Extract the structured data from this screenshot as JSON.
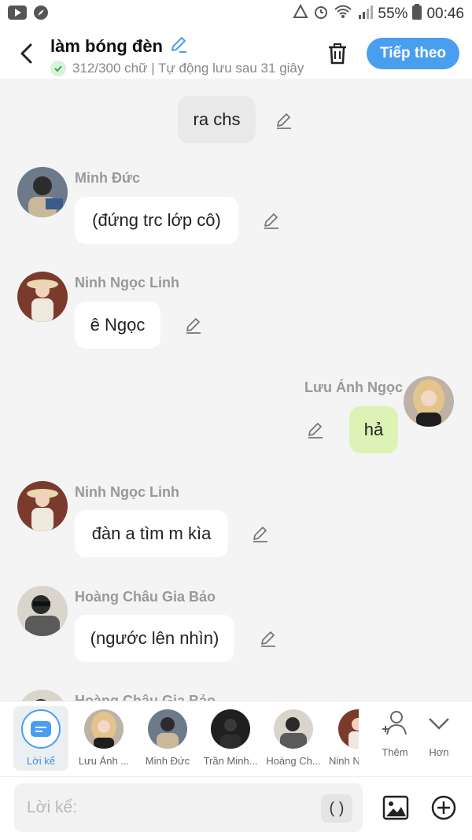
{
  "status_bar": {
    "left_icons": [
      "youtube-icon",
      "compass-icon"
    ],
    "right_icons": [
      "recycle-icon",
      "alarm-icon",
      "wifi-icon",
      "signal-icon"
    ],
    "battery": "55%",
    "time": "00:46"
  },
  "header": {
    "title": "làm bóng đèn",
    "subtitle": "312/300 chữ | Tự động lưu sau 31 giây",
    "next_label": "Tiếp theo",
    "accent": "#4a9ef0"
  },
  "messages": [
    {
      "type": "narration",
      "text": "ra chs"
    },
    {
      "type": "left",
      "name": "Minh Đức",
      "text": "(đứng trc lớp cô)"
    },
    {
      "type": "left",
      "name": "Ninh Ngọc Linh",
      "text": "ê Ngọc"
    },
    {
      "type": "right",
      "name": "Lưu Ánh Ngọc",
      "text": "hả"
    },
    {
      "type": "left",
      "name": "Ninh Ngọc Linh",
      "text": "đàn a tìm m kìa"
    },
    {
      "type": "left",
      "name": "Hoàng Châu Gia Bảo",
      "text": "(ngước lên nhìn)"
    },
    {
      "type": "left",
      "name": "Hoàng Châu Gia Bảo",
      "text": ""
    }
  ],
  "characters": [
    {
      "label": "Lời kể"
    },
    {
      "label": "Lưu Ánh ..."
    },
    {
      "label": "Minh Đức"
    },
    {
      "label": "Trần Minh..."
    },
    {
      "label": "Hoàng Ch..."
    },
    {
      "label": "Ninh N"
    }
  ],
  "strip_actions": {
    "add_label": "Thêm",
    "more_label": "Hơn"
  },
  "input": {
    "placeholder": "Lời kể:",
    "paren_label": "( )"
  }
}
